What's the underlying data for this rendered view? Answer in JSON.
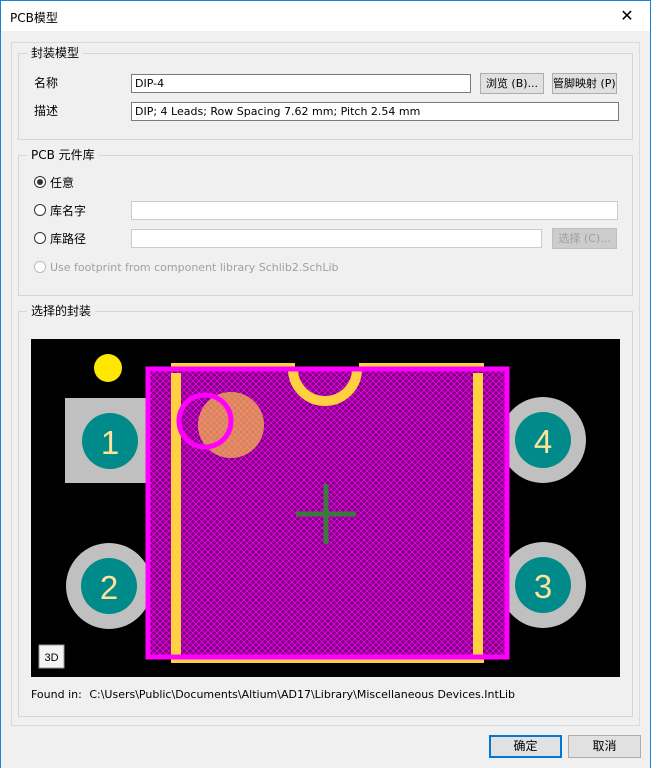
{
  "window": {
    "title": "PCB模型"
  },
  "footprint_model": {
    "group_label": "封装模型",
    "name_label": "名称",
    "name_value": "DIP-4",
    "browse_label": "浏览 (B)...",
    "pin_map_label": "管脚映射 (P)...",
    "desc_label": "描述",
    "desc_value": "DIP; 4 Leads; Row Spacing 7.62 mm; Pitch 2.54 mm"
  },
  "pcb_library": {
    "group_label": "PCB 元件库",
    "any_label": "任意",
    "any_checked": true,
    "lib_name_label": "库名字",
    "lib_name_value": "",
    "lib_path_label": "库路径",
    "lib_path_value": "",
    "choose_label": "选择 (C)...",
    "use_footprint_label": "Use footprint from component library Schlib2.SchLib"
  },
  "selected_footprint": {
    "group_label": "选择的封装",
    "view_mode_label": "3D",
    "pads": [
      {
        "number": "1",
        "shape": "square"
      },
      {
        "number": "2",
        "shape": "round"
      },
      {
        "number": "3",
        "shape": "round"
      },
      {
        "number": "4",
        "shape": "round"
      }
    ],
    "found_in_label": "Found in:",
    "found_in_path": "C:\\Users\\Public\\Documents\\Altium\\AD17\\Library\\Miscellaneous Devices.IntLib"
  },
  "buttons": {
    "ok": "确定",
    "cancel": "取消"
  },
  "colors": {
    "board_bg": "#000000",
    "body_fill": "#800080",
    "outline": "#ff00ff",
    "silk": "#ffd040",
    "pad_ring": "#c0c0c0",
    "pad_core": "#008a8a",
    "pad_label": "#ffe39a",
    "center_cross": "#3a7a3a"
  },
  "icons": {
    "close": "close-icon"
  }
}
